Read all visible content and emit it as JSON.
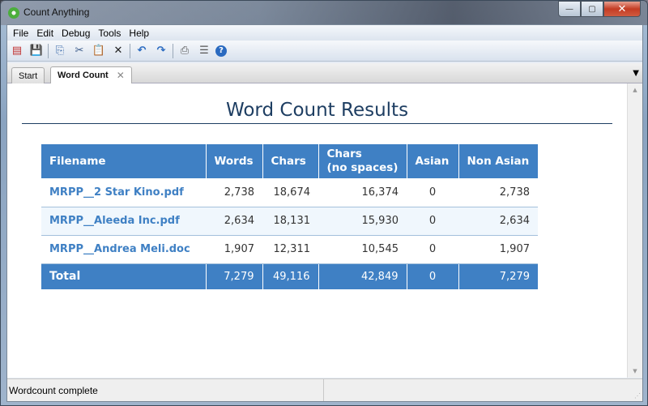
{
  "window": {
    "title": "Count Anything",
    "controls": {
      "minimize": "—",
      "maximize": "▢",
      "close": "✕"
    }
  },
  "menu": [
    "File",
    "Edit",
    "Debug",
    "Tools",
    "Help"
  ],
  "toolbar": [
    {
      "name": "open-project-icon",
      "glyph": "▤"
    },
    {
      "name": "save-icon",
      "glyph": "💾"
    },
    {
      "name": "copy-icon",
      "glyph": "⎘"
    },
    {
      "name": "cut-icon",
      "glyph": "✂"
    },
    {
      "name": "paste-icon",
      "glyph": "📋"
    },
    {
      "name": "delete-icon",
      "glyph": "✕"
    },
    {
      "name": "undo-icon",
      "glyph": "↶"
    },
    {
      "name": "redo-icon",
      "glyph": "↷"
    },
    {
      "name": "print-icon",
      "glyph": "⎙"
    },
    {
      "name": "properties-icon",
      "glyph": "☰"
    },
    {
      "name": "help-icon",
      "glyph": "?"
    }
  ],
  "tabs": [
    {
      "label": "Start",
      "active": false
    },
    {
      "label": "Word Count",
      "active": true,
      "close": "✕"
    }
  ],
  "tab_menu": "▼",
  "report": {
    "title": "Word Count Results",
    "headers": {
      "filename": "Filename",
      "words": "Words",
      "chars": "Chars",
      "chars_no_spaces_1": "Chars",
      "chars_no_spaces_2": "(no spaces)",
      "asian": "Asian",
      "non_asian": "Non Asian"
    },
    "rows": [
      {
        "filename": "MRPP__2 Star Kino.pdf",
        "words": "2,738",
        "chars": "18,674",
        "chars_no_spaces": "16,374",
        "asian": "0",
        "non_asian": "2,738"
      },
      {
        "filename": "MRPP__Aleeda Inc.pdf",
        "words": "2,634",
        "chars": "18,131",
        "chars_no_spaces": "15,930",
        "asian": "0",
        "non_asian": "2,634"
      },
      {
        "filename": "MRPP__Andrea Meli.doc",
        "words": "1,907",
        "chars": "12,311",
        "chars_no_spaces": "10,545",
        "asian": "0",
        "non_asian": "1,907"
      }
    ],
    "total": {
      "label": "Total",
      "words": "7,279",
      "chars": "49,116",
      "chars_no_spaces": "42,849",
      "asian": "0",
      "non_asian": "7,279"
    }
  },
  "scrollbar": {
    "up": "▲",
    "down": "▼"
  },
  "status": {
    "message": "Wordcount complete",
    "secondary": "",
    "grip": "⋰"
  },
  "colors": {
    "header_bg": "#3f80c4",
    "title": "#1e3e62",
    "alt_row": "#f0f7fd"
  }
}
